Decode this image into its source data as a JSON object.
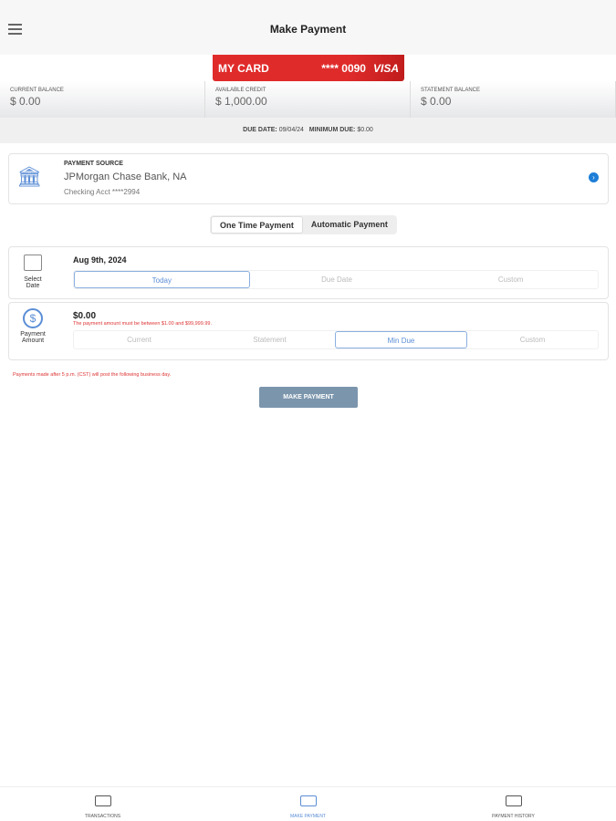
{
  "header": {
    "title": "Make Payment"
  },
  "card": {
    "name": "MY CARD",
    "number": "**** 0090",
    "brand": "VISA"
  },
  "balances": [
    {
      "label": "CURRENT BALANCE",
      "value": "$ 0.00"
    },
    {
      "label": "AVAILABLE CREDIT",
      "value": "$ 1,000.00"
    },
    {
      "label": "STATEMENT BALANCE",
      "value": "$ 0.00"
    }
  ],
  "due": {
    "due_label": "DUE DATE:",
    "due_value": "09/04/24",
    "min_label": "MINIMUM DUE:",
    "min_value": "$0.00"
  },
  "source": {
    "label": "PAYMENT SOURCE",
    "bank": "JPMorgan Chase Bank, NA",
    "account": "Checking Acct  ****2994"
  },
  "payment_type": {
    "options": [
      "One Time Payment",
      "Automatic Payment"
    ]
  },
  "date": {
    "label": "Select Date",
    "value": "Aug 9th, 2024",
    "options": [
      "Today",
      "Due Date",
      "Custom"
    ]
  },
  "amount": {
    "label": "Payment Amount",
    "value": "$0.00",
    "error": "The payment amount must be between $1.00 and $99,999.99.",
    "options": [
      "Current",
      "Statement",
      "Min Due",
      "Custom"
    ]
  },
  "note": "Payments made after 5 p.m. (CST) will post the following business day.",
  "submit": "MAKE PAYMENT",
  "tabs": [
    "TRANSACTIONS",
    "MAKE PAYMENT",
    "PAYMENT HISTORY"
  ]
}
